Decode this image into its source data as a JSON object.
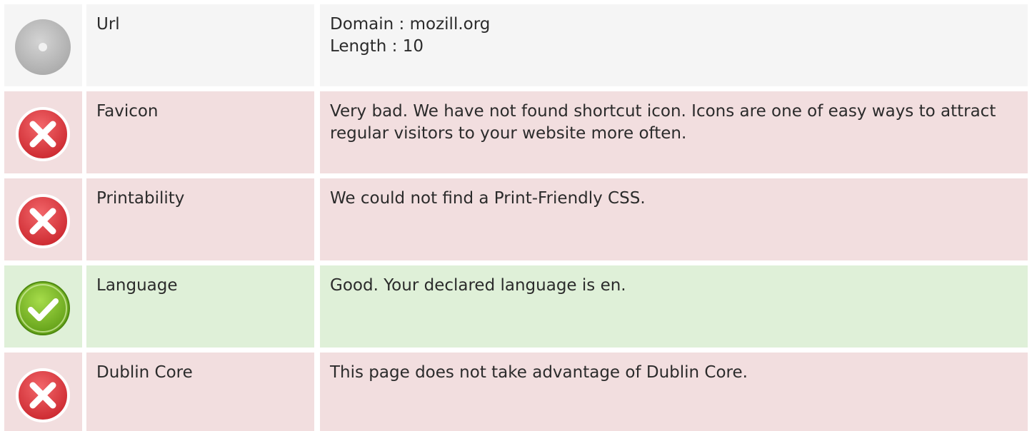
{
  "rows": [
    {
      "label": "Url",
      "status": "neutral",
      "icon": "neutral-disc-icon",
      "lines": [
        "Domain : mozill.org",
        "Length : 10"
      ]
    },
    {
      "label": "Favicon",
      "status": "bad",
      "icon": "error-icon",
      "lines": [
        "Very bad. We have not found shortcut icon. Icons are one of easy ways to attract regular visitors to your website more often."
      ]
    },
    {
      "label": "Printability",
      "status": "bad",
      "icon": "error-icon",
      "lines": [
        "We could not find a Print-Friendly CSS."
      ]
    },
    {
      "label": "Language",
      "status": "good",
      "icon": "success-icon",
      "lines": [
        "Good. Your declared language is en."
      ]
    },
    {
      "label": "Dublin Core",
      "status": "bad",
      "icon": "error-icon",
      "lines": [
        "This page does not take advantage of Dublin Core."
      ]
    }
  ],
  "colors": {
    "neutral_bg": "#f5f5f5",
    "bad_bg": "#f2dedf",
    "good_bg": "#dff0d8",
    "error_red": "#e23a3f",
    "success_green": "#7cc221",
    "neutral_gray": "#bdbdbd"
  }
}
